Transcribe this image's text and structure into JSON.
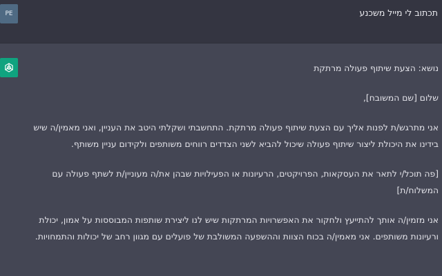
{
  "conversation": {
    "user": {
      "avatar_text": "PE",
      "message": "תכתוב לי מייל משכנע"
    },
    "assistant": {
      "paragraphs": [
        "נושא: הצעת שיתוף פעולה מרתקת",
        "שלום [שם המשובח],",
        "אני מתרגש/ת לפנות אליך עם הצעת שיתוף פעולה מרתקת. התחשבתי ושקלתי היטב את העניין, ואני מאמין/ה שיש בידינו את היכולת ליצור שיתוף פעולה שיכול להביא לשני הצדדים רווחים משותפים ולקידום עניין משותף.",
        "[פה תוכל/י לתאר את העסקאות, הפרויקטים, הרעיונות או הפעילויות שבהן את/ה מעוניין/ת לשתף פעולה עם המשלוח/ת]",
        "אני מזמין/ה אותך להתייעץ ולחקור את האפשרויות המרתקות שיש לנו ליצירת שותפות המבוססות על אמון, יכולת ורעיונות משותפים. אני מאמין/ה בכוח הצוות וההשפעה המשולבת של פועלים עם מגוון רחב של יכולות והתמחויות."
      ]
    }
  }
}
